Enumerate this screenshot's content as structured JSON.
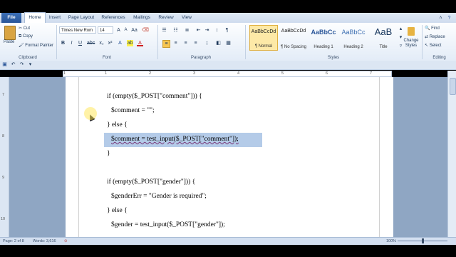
{
  "tabs": [
    "File",
    "Home",
    "Insert",
    "Page Layout",
    "References",
    "Mailings",
    "Review",
    "View"
  ],
  "clipboard": {
    "paste": "Paste",
    "cut": "Cut",
    "copy": "Copy",
    "format_painter": "Format Painter",
    "group": "Clipboard"
  },
  "font": {
    "name": "Times New Rom",
    "size": "14",
    "group": "Font"
  },
  "paragraph": {
    "group": "Paragraph"
  },
  "styles": {
    "items": [
      {
        "preview": "AaBbCcDd",
        "label": "¶ Normal"
      },
      {
        "preview": "AaBbCcDd",
        "label": "¶ No Spacing"
      },
      {
        "preview": "AaBbCc",
        "label": "Heading 1"
      },
      {
        "preview": "AaBbCc",
        "label": "Heading 2"
      },
      {
        "preview": "AaB",
        "label": "Title"
      }
    ],
    "change": "Change Styles",
    "group": "Styles"
  },
  "editing": {
    "find": "Find",
    "replace": "Replace",
    "select": "Select",
    "group": "Editing"
  },
  "ruler_h": [
    "1",
    "1",
    "2",
    "3",
    "4",
    "5",
    "6",
    "7"
  ],
  "ruler_v": [
    "7",
    "8",
    "9",
    "10"
  ],
  "code_lines": [
    "if (empty($_POST[\"comment\"])) {",
    "$comment = \"\";",
    "} else {",
    "$comment = test_input($_POST[\"comment\"]);",
    "}",
    "if (empty($_POST[\"gender\"])) {",
    "$genderErr = \"Gender is required\";",
    "} else {",
    "$gender = test_input($_POST[\"gender\"]);"
  ],
  "status": {
    "page": "Page: 2 of 8",
    "words": "Words: 3,616",
    "zoom": "100%"
  }
}
